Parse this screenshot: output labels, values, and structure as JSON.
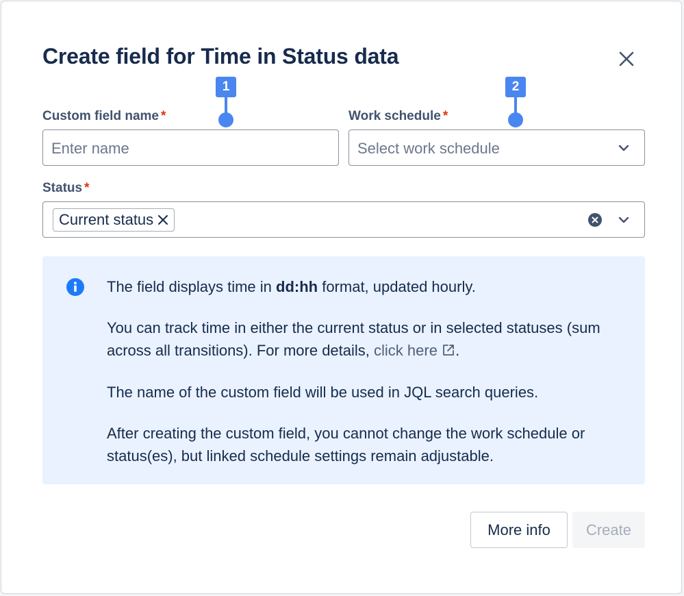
{
  "dialog": {
    "title": "Create field for Time in Status data",
    "close_icon": "close-icon"
  },
  "fields": {
    "custom_field_name": {
      "label": "Custom field name",
      "required_mark": "*",
      "placeholder": "Enter name",
      "value": ""
    },
    "work_schedule": {
      "label": "Work schedule",
      "required_mark": "*",
      "placeholder": "Select work schedule",
      "icon": "chevron-down-icon"
    },
    "status": {
      "label": "Status",
      "required_mark": "*",
      "selected_tags": [
        "Current status"
      ],
      "clear_icon": "clear-circle-icon",
      "icon": "chevron-down-icon"
    }
  },
  "markers": [
    {
      "label": "1"
    },
    {
      "label": "2"
    }
  ],
  "info": {
    "icon": "info-icon",
    "line1_before": "The field displays time in ",
    "line1_bold": "dd:hh",
    "line1_after": " format, updated hourly.",
    "line2_before": "You can track time in either the current status or in selected statuses (sum across all transitions). For more details, ",
    "line2_link": "click here",
    "line2_after": ".",
    "line3": "The name of the custom field will be used in JQL search queries.",
    "line4": "After creating the custom field, you cannot change the work schedule or status(es), but linked schedule settings remain adjustable."
  },
  "footer": {
    "more_info_label": "More info",
    "create_label": "Create"
  },
  "colors": {
    "accent_marker": "#4a86f0",
    "info_background": "#e9f2fe",
    "required": "#de350b"
  }
}
